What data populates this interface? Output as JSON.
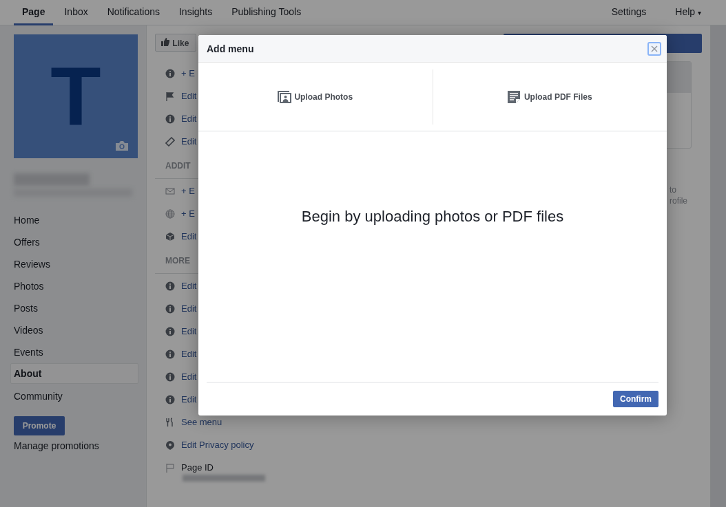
{
  "top_nav": {
    "tabs": [
      {
        "label": "Page",
        "selected": true
      },
      {
        "label": "Inbox",
        "selected": false
      },
      {
        "label": "Notifications",
        "selected": false
      },
      {
        "label": "Insights",
        "selected": false
      },
      {
        "label": "Publishing Tools",
        "selected": false
      }
    ],
    "right": [
      {
        "label": "Settings",
        "kind": "plain"
      },
      {
        "label": "Help",
        "kind": "dropdown",
        "caret": "▾"
      }
    ]
  },
  "sidebar": {
    "avatar_letter": "T",
    "items": [
      {
        "label": "Home",
        "selected": false
      },
      {
        "label": "Offers",
        "selected": false
      },
      {
        "label": "Reviews",
        "selected": false
      },
      {
        "label": "Photos",
        "selected": false
      },
      {
        "label": "Posts",
        "selected": false
      },
      {
        "label": "Videos",
        "selected": false
      },
      {
        "label": "Events",
        "selected": false
      },
      {
        "label": "About",
        "selected": true
      },
      {
        "label": "Community",
        "selected": false
      }
    ],
    "promote_button": "Promote",
    "manage_link": "Manage promotions"
  },
  "content": {
    "like_button": "Like",
    "rows": [
      {
        "kind": "info",
        "text": "+ E",
        "link": true
      },
      {
        "kind": "flag",
        "text": "Edit",
        "link": true
      },
      {
        "kind": "info",
        "text": "Edit",
        "link": true
      },
      {
        "kind": "tag",
        "text": "Edit",
        "link": true
      },
      {
        "kind": "heading",
        "text": "ADDIT"
      },
      {
        "kind": "mail",
        "text": "+ E",
        "link": true
      },
      {
        "kind": "globe",
        "text": "+ E",
        "link": true
      },
      {
        "kind": "box",
        "text": "Edit",
        "link": true
      },
      {
        "kind": "heading",
        "text": "MORE"
      },
      {
        "kind": "info",
        "text": "Edit",
        "link": true
      },
      {
        "kind": "info",
        "text": "Edit",
        "link": true
      },
      {
        "kind": "info",
        "text": "Edit",
        "link": true
      },
      {
        "kind": "info",
        "text": "Edit",
        "link": true
      },
      {
        "kind": "info",
        "text": "Edit",
        "link": true
      },
      {
        "kind": "info",
        "text": "Edit",
        "link": true
      },
      {
        "kind": "menu",
        "text": "See menu",
        "link": true
      },
      {
        "kind": "shield",
        "text": "Edit Privacy policy",
        "link": true
      },
      {
        "kind": "flag-outline",
        "text": "Page ID",
        "link": false
      }
    ],
    "side_text": [
      "to",
      "rofile"
    ]
  },
  "dialog": {
    "title": "Add menu",
    "options": [
      {
        "kind": "photos",
        "label": "Upload Photos"
      },
      {
        "kind": "pdf",
        "label": "Upload PDF Files"
      }
    ],
    "message": "Begin by uploading photos or PDF files",
    "confirm_button": "Confirm"
  }
}
